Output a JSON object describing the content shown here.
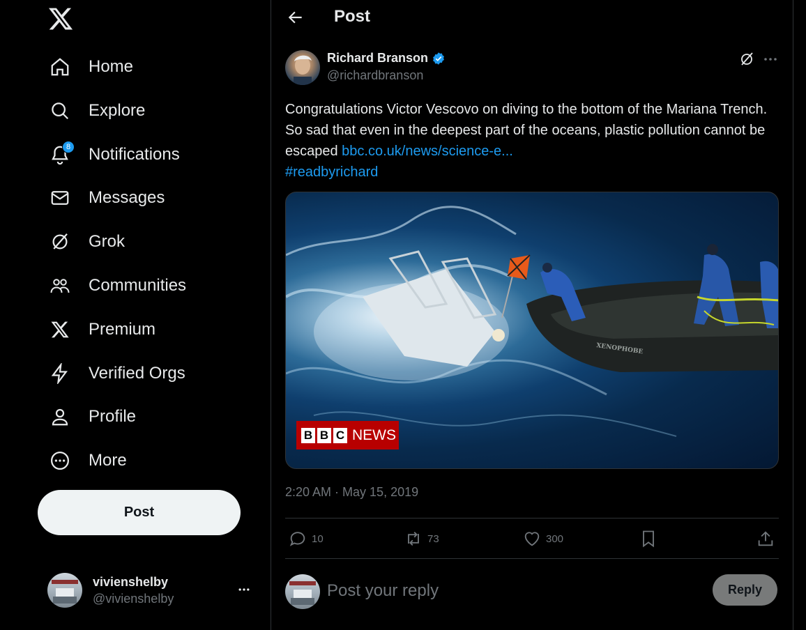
{
  "sidebar": {
    "items": [
      {
        "label": "Home",
        "icon": "home-icon"
      },
      {
        "label": "Explore",
        "icon": "search-icon"
      },
      {
        "label": "Notifications",
        "icon": "bell-icon",
        "badge": "8"
      },
      {
        "label": "Messages",
        "icon": "envelope-icon"
      },
      {
        "label": "Grok",
        "icon": "grok-icon"
      },
      {
        "label": "Communities",
        "icon": "people-icon"
      },
      {
        "label": "Premium",
        "icon": "x-logo-icon"
      },
      {
        "label": "Verified Orgs",
        "icon": "lightning-icon"
      },
      {
        "label": "Profile",
        "icon": "person-icon"
      },
      {
        "label": "More",
        "icon": "more-circle-icon"
      }
    ],
    "post_label": "Post",
    "account": {
      "name": "vivienshelby",
      "handle": "@vivienshelby"
    }
  },
  "header": {
    "title": "Post"
  },
  "tweet": {
    "author_name": "Richard Branson",
    "author_handle": "@richardbranson",
    "text": "Congratulations Victor Vescovo on diving to the bottom of the Mariana Trench. So sad that even in the deepest part of the oceans, plastic pollution cannot be escaped ",
    "link": "bbc.co.uk/news/science-e...",
    "hashtag": "#readbyrichard",
    "media": {
      "badge_letters": [
        "B",
        "B",
        "C"
      ],
      "badge_text": "NEWS",
      "boat_label": "XENOPHOBE"
    },
    "timestamp": "2:20 AM · May 15, 2019",
    "stats": {
      "replies": "10",
      "reposts": "73",
      "likes": "300"
    }
  },
  "reply": {
    "placeholder": "Post your reply",
    "button": "Reply"
  },
  "colors": {
    "accent": "#1d9bf0",
    "background": "#000000",
    "text": "#e7e9ea",
    "muted": "#71767b",
    "bbc_red": "#b80000"
  }
}
